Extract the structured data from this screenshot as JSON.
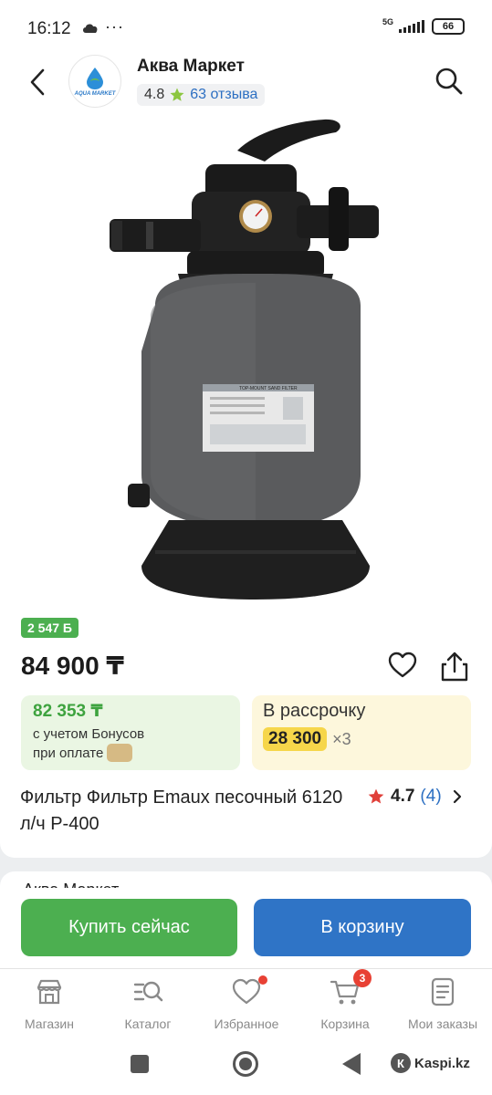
{
  "status_bar": {
    "time": "16:12",
    "dots": "···",
    "network": "5G",
    "battery": "66"
  },
  "header": {
    "shop_name": "Аква Маркет",
    "logo_text": "AQUA MARKET",
    "rating": "4.8",
    "reviews": "63 отзыва"
  },
  "product": {
    "image_label": "TOP-MOUNT SAND FILTER",
    "bonus_badge": "2 547 Б",
    "price": "84 900 ₸",
    "bonus_price": "82 353 ₸",
    "bonus_note_1": "с учетом Бонусов",
    "bonus_note_2": "при оплате",
    "installment_title": "В рассрочку",
    "installment_amount": "28 300",
    "installment_times": "×3",
    "title": "Фильтр Фильтр Emaux песочный 6120 л/ч P-400",
    "rating": "4.7",
    "rating_count": "(4)"
  },
  "seller": {
    "label": "Аква Маркет"
  },
  "actions": {
    "buy_now": "Купить сейчас",
    "to_cart": "В корзину"
  },
  "tabs": [
    {
      "label": "Магазин",
      "icon": "store-icon"
    },
    {
      "label": "Каталог",
      "icon": "catalog-icon"
    },
    {
      "label": "Избранное",
      "icon": "heart-icon"
    },
    {
      "label": "Корзина",
      "icon": "cart-icon",
      "badge": "3"
    },
    {
      "label": "Мои заказы",
      "icon": "orders-icon"
    }
  ],
  "footer": {
    "brand": "Kaspi.kz"
  },
  "colors": {
    "green": "#4caf50",
    "blue": "#2f74c6",
    "link": "#2c6fc2",
    "yellow": "#f6d64a",
    "red": "#e84134"
  }
}
